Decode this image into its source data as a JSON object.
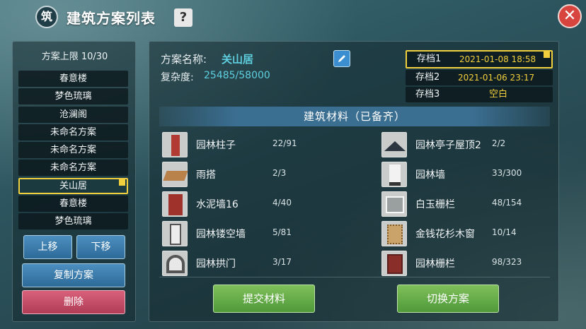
{
  "title": "建筑方案列表",
  "help_label": "?",
  "close_label": "✕",
  "title_icon_glyph": "筑",
  "left": {
    "limit_text": "方案上限 10/30",
    "plans": [
      {
        "label": "春意楼"
      },
      {
        "label": "梦色琉璃"
      },
      {
        "label": "沧澜阁"
      },
      {
        "label": "未命名方案"
      },
      {
        "label": "未命名方案"
      },
      {
        "label": "未命名方案"
      },
      {
        "label": "关山居",
        "selected": true
      },
      {
        "label": "春意楼"
      },
      {
        "label": "梦色琉璃"
      }
    ],
    "move_up": "上移",
    "move_down": "下移",
    "copy": "复制方案",
    "delete": "删除"
  },
  "main": {
    "name_label": "方案名称:",
    "name_value": "关山居",
    "complexity_label": "复杂度:",
    "complexity_value": "25485/58000",
    "saves": [
      {
        "name": "存档1",
        "date": "2021-01-08 18:58",
        "active": true
      },
      {
        "name": "存档2",
        "date": "2021-01-06 23:17"
      },
      {
        "name": "存档3",
        "empty": "空白"
      }
    ],
    "materials_header": "建筑材料（已备齐）",
    "materials_left": [
      {
        "name": "园林柱子",
        "count": "22/91",
        "icon": "pillar-icon"
      },
      {
        "name": "雨搭",
        "count": "2/3",
        "icon": "awning-icon"
      },
      {
        "name": "水泥墙16",
        "count": "4/40",
        "icon": "cement-wall-icon"
      },
      {
        "name": "园林镂空墙",
        "count": "5/81",
        "icon": "hollow-wall-icon"
      },
      {
        "name": "园林拱门",
        "count": "3/17",
        "icon": "arch-door-icon"
      }
    ],
    "materials_right": [
      {
        "name": "园林亭子屋顶2",
        "count": "2/2",
        "icon": "pavilion-roof-icon"
      },
      {
        "name": "园林墙",
        "count": "33/300",
        "icon": "garden-wall-icon"
      },
      {
        "name": "白玉栅栏",
        "count": "48/154",
        "icon": "jade-fence-icon"
      },
      {
        "name": "金钱花杉木窗",
        "count": "10/14",
        "icon": "wood-window-icon"
      },
      {
        "name": "园林栅栏",
        "count": "98/323",
        "icon": "garden-fence-icon"
      }
    ],
    "submit": "提交材料",
    "switch": "切换方案"
  }
}
